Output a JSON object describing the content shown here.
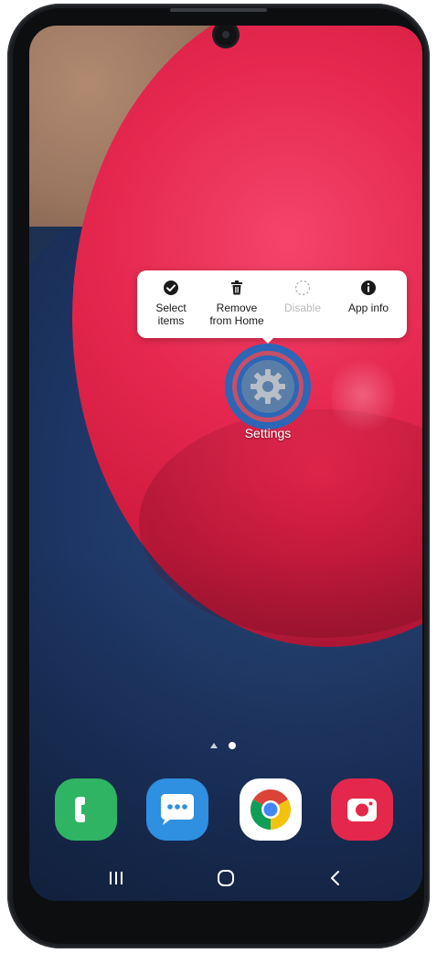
{
  "popup_menu": {
    "items": [
      {
        "label": "Select\nitems",
        "icon": "check-circle-icon",
        "enabled": true
      },
      {
        "label": "Remove\nfrom Home",
        "icon": "trash-icon",
        "enabled": true
      },
      {
        "label": "Disable",
        "icon": "dashed-circle-icon",
        "enabled": false
      },
      {
        "label": "App info",
        "icon": "info-icon",
        "enabled": true
      }
    ]
  },
  "home": {
    "selected_app_label": "Settings",
    "page_count": 2,
    "current_page": 2
  },
  "dock": {
    "apps": [
      {
        "name": "phone",
        "icon": "phone-icon",
        "color": "#2fb463"
      },
      {
        "name": "messages",
        "icon": "chat-bubble-icon",
        "color": "#2f8fe0"
      },
      {
        "name": "chrome",
        "icon": "chrome-icon",
        "color": "#ffffff"
      },
      {
        "name": "camera",
        "icon": "camera-icon",
        "color": "#e3284c"
      }
    ]
  },
  "navbar": {
    "buttons": [
      "recent-apps-icon",
      "home-icon",
      "back-icon"
    ]
  }
}
